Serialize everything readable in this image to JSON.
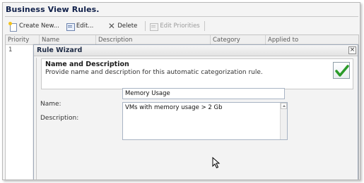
{
  "page": {
    "title": "Business View Rules."
  },
  "toolbar": {
    "create_new_label": "Create New...",
    "edit_label": "Edit...",
    "delete_label": "Delete",
    "edit_priorities_label": "Edit Priorities"
  },
  "grid": {
    "columns": [
      "Priority",
      "Name",
      "Description",
      "Category",
      "Applied to"
    ],
    "rows": [
      {
        "priority": "1"
      }
    ]
  },
  "dialog": {
    "title": "Rule Wizard",
    "close_label": "×",
    "step_title": "Name and Description",
    "step_description": "Provide name and description for this automatic categorization rule.",
    "name_label": "Name:",
    "name_value": "Memory Usage",
    "description_label": "Description:",
    "description_value": "VMs with memory usage > 2 Gb"
  },
  "colors": {
    "title_text": "#10204a",
    "check_green": "#2a9b2a",
    "accent_border": "#9da8b8"
  },
  "icons": [
    "create-new-icon",
    "edit-icon",
    "delete-icon",
    "edit-priorities-icon",
    "check-icon",
    "close-icon",
    "mouse-cursor-icon"
  ]
}
